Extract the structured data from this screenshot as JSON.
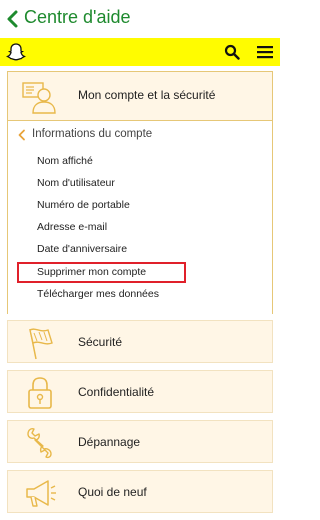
{
  "header": {
    "title": "Centre d'aide"
  },
  "icons": {
    "back": "chevron-left-icon",
    "logo": "snapchat-ghost-icon",
    "search": "search-icon",
    "menu": "hamburger-menu-icon"
  },
  "colors": {
    "accent_green": "#1e8a2e",
    "brand_yellow": "#fffc00",
    "card_bg": "#fff6e6",
    "highlight_red": "#e0202a"
  },
  "sections": {
    "account": {
      "label": "Mon compte et la sécurité",
      "sub_title": "Informations du compte",
      "items": [
        "Nom affiché",
        "Nom d'utilisateur",
        "Numéro de portable",
        "Adresse e-mail",
        "Date d'anniversaire",
        "Supprimer mon compte",
        "Télécharger mes données"
      ],
      "highlighted_item": "Supprimer mon compte"
    },
    "security": {
      "label": "Sécurité"
    },
    "privacy": {
      "label": "Confidentialité"
    },
    "troubleshooting": {
      "label": "Dépannage"
    },
    "whats_new": {
      "label": "Quoi de neuf"
    }
  }
}
